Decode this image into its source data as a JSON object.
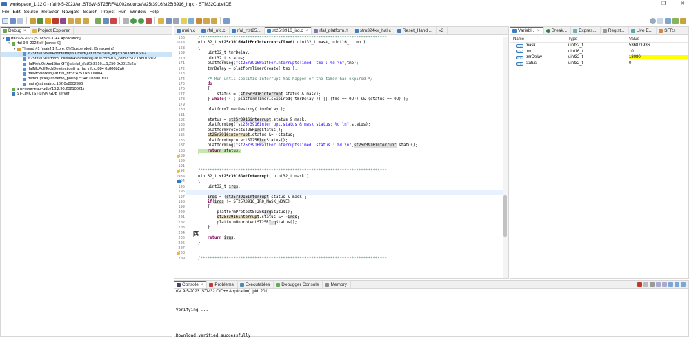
{
  "window": {
    "title": "workspace_1.12.0 - rfal 9-5-2023/en.STSW-ST25RFAL002/source/st25r3916/st25r3916_irq.c - STM32CubeIDE",
    "controls": [
      "—",
      "❐",
      "✕"
    ]
  },
  "menu": [
    "File",
    "Edit",
    "Source",
    "Refactor",
    "Navigate",
    "Search",
    "Project",
    "Run",
    "Window",
    "Help"
  ],
  "debug_panel": {
    "tabs": [
      "Debug",
      "Project Explorer"
    ],
    "tree": [
      {
        "indent": 0,
        "twisty": "▾",
        "icon": "c-app",
        "text": "rfal 9-5-2023 [STM32 C/C++ Application]"
      },
      {
        "indent": 1,
        "twisty": "▾",
        "icon": "elf",
        "text": "rfal 9-5-2023.elf [cores: 0]"
      },
      {
        "indent": 2,
        "twisty": "▾",
        "icon": "thread",
        "text": "Thread #1 [main] 1 [core: 0] (Suspended : Breakpoint)"
      },
      {
        "indent": 3,
        "twisty": "",
        "icon": "frame",
        "text": "st25r3916WaitForInterruptsTimed() at st25r3916_irq.c:188 0x8016fa2",
        "selected": true
      },
      {
        "indent": 3,
        "twisty": "",
        "icon": "frame",
        "text": "st25r3916PerformCollisionAvoidance() at st25r3916_com.c:517 0x8016312"
      },
      {
        "indent": 3,
        "twisty": "",
        "icon": "frame",
        "text": "rfalFieldOnAndStartGT() at rfal_rfst25r3916.c:1,250 0x8012b2a"
      },
      {
        "indent": 3,
        "twisty": "",
        "icon": "frame",
        "text": "rfalNfcPollTechDetetection() at rfal_nfc.c:884 0x800b2a6"
      },
      {
        "indent": 3,
        "twisty": "",
        "icon": "frame",
        "text": "rfalNfcWorker() at rfal_nfc.c:425 0x800ab04"
      },
      {
        "indent": 3,
        "twisty": "",
        "icon": "frame",
        "text": "demoCycle() at demo_polling.c:346 0x8001f00"
      },
      {
        "indent": 3,
        "twisty": "",
        "icon": "frame",
        "text": "main() at main.c:162 0x8002996"
      },
      {
        "indent": 1,
        "twisty": "",
        "icon": "gdb",
        "text": "arm-none-eabi-gdb (10.2.90.20210621)"
      },
      {
        "indent": 1,
        "twisty": "",
        "icon": "stlink",
        "text": "ST-LINK (ST-LINK GDB server)"
      }
    ]
  },
  "editor": {
    "tabs": [
      {
        "label": "main.c",
        "active": false
      },
      {
        "label": "rfal_nfc.c",
        "active": false
      },
      {
        "label": "rfal_rfst25...",
        "active": false
      },
      {
        "label": "st25r3916_irq.c",
        "active": true
      },
      {
        "label": "rfal_platform.h",
        "active": false
      },
      {
        "label": "stm324xx_hal.c",
        "active": false
      },
      {
        "label": "Reset_Handl...",
        "active": false
      }
    ],
    "overflow": "»3"
  },
  "variables_panel": {
    "tabs": [
      "Variabl...",
      "Break...",
      "Expres...",
      "Regist...",
      "Live E...",
      "SFRs"
    ],
    "columns": [
      "Name",
      "Type",
      "Value"
    ],
    "rows": [
      {
        "name": "mask",
        "type": "uint32_t",
        "value": "536871936",
        "highlight": false
      },
      {
        "name": "tmo",
        "type": "uint16_t",
        "value": "10",
        "highlight": false
      },
      {
        "name": "tmrDelay",
        "type": "uint32_t",
        "value": "18080",
        "highlight": true
      },
      {
        "name": "status",
        "type": "uint32_t",
        "value": "0",
        "highlight": false
      }
    ],
    "highlight_color": "#ffff00"
  },
  "console_panel": {
    "tabs": [
      "Console",
      "Problems",
      "Executables",
      "Debugger Console",
      "Memory"
    ],
    "header": "rfal 9-5-2023 [STM32 C/C++ Application] [pid: 201]",
    "lines": [
      "Verifying ...",
      "",
      "",
      "Download verified successfully"
    ]
  },
  "ime_indicator": "英"
}
